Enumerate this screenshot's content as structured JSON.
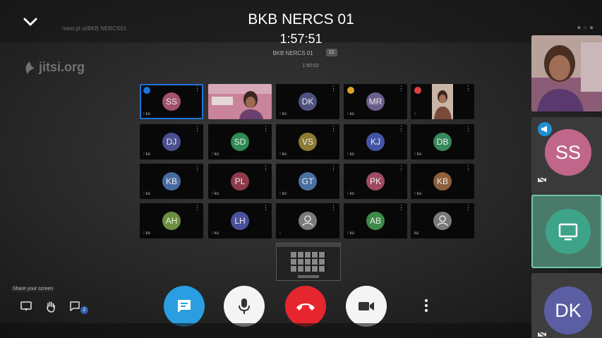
{
  "header": {
    "title": "BKB NERCS 01",
    "duration": "1:57:51"
  },
  "browser": {
    "url": "meet.jit.si/BKB NERCS01"
  },
  "logo": {
    "text": "jitsi.org"
  },
  "conference": {
    "title_small": "BKB NERCS 01",
    "participant_count": "21",
    "timer_small": "1:50:53"
  },
  "grid": {
    "tiles": [
      {
        "initials": "SS",
        "color": "#a2516e",
        "status": "⁝ ko",
        "active": true,
        "badge": "#1e72d8"
      },
      {
        "initials": "",
        "color": "",
        "status": "",
        "video": "pink",
        "active": false
      },
      {
        "initials": "DK",
        "color": "#4f5180",
        "status": "⁝ ko",
        "active": false
      },
      {
        "initials": "MR",
        "color": "#6a5f8c",
        "status": "⁝ ko",
        "active": false,
        "badge": "#d8a624"
      },
      {
        "initials": "",
        "color": "",
        "status": "⁝",
        "video": "person",
        "active": false,
        "badge": "#e04040"
      },
      {
        "initials": "DJ",
        "color": "#4b4f90",
        "status": "⁝ ko",
        "active": false
      },
      {
        "initials": "SD",
        "color": "#2f8a54",
        "status": "⁝ ko",
        "active": false
      },
      {
        "initials": "VS",
        "color": "#8e7a35",
        "status": "⁝ ko",
        "active": false
      },
      {
        "initials": "KJ",
        "color": "#4454a5",
        "status": "⁝ ko",
        "active": false
      },
      {
        "initials": "DB",
        "color": "#37885a",
        "status": "⁝ ko",
        "active": false
      },
      {
        "initials": "KB",
        "color": "#4669a0",
        "status": "⁝ ko",
        "active": false
      },
      {
        "initials": "PL",
        "color": "#8f3a4b",
        "status": "⁝ ko",
        "active": false
      },
      {
        "initials": "GT",
        "color": "#4970a0",
        "status": "⁝ ko",
        "active": false
      },
      {
        "initials": "PK",
        "color": "#a04a64",
        "status": "⁝ ko",
        "active": false
      },
      {
        "initials": "KB",
        "color": "#8e5f3d",
        "status": "⁝ ko",
        "active": false
      },
      {
        "initials": "AH",
        "color": "#6b8f3d",
        "status": "⁝ ko",
        "active": false
      },
      {
        "initials": "LH",
        "color": "#48519a",
        "status": "⁝ ko",
        "active": false
      },
      {
        "initials": "",
        "color": "#7a7a7a",
        "status": "⁝",
        "active": false,
        "avatar_icon": true
      },
      {
        "initials": "AB",
        "color": "#3f8a4a",
        "status": "⁝ ko",
        "active": false
      },
      {
        "initials": "",
        "color": "#7a7a7a",
        "status": "ko",
        "active": false,
        "avatar_icon": true
      }
    ]
  },
  "toolbar": {
    "share_label": "Share your screen",
    "chat_badge": "2"
  },
  "filmstrip": {
    "tiles": [
      {
        "initials": "SS"
      },
      {
        "initials": "DK"
      }
    ]
  },
  "colors": {
    "chat": "#2a9ee0",
    "hangup": "#e5262e",
    "active_border": "#1f72d8",
    "share_border": "#6ec9a9"
  }
}
